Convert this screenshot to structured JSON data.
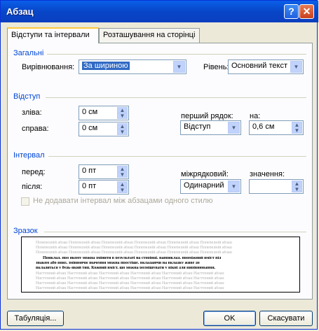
{
  "window": {
    "title": "Абзац",
    "help_glyph": "?",
    "close_glyph": "✕"
  },
  "tabs": [
    {
      "label": "Відступи та інтервали",
      "active": true
    },
    {
      "label": "Розташування на сторінці",
      "active": false
    }
  ],
  "general": {
    "section_label": "Загальні",
    "alignment_label": "Вирівнювання:",
    "alignment_value": "За шириною",
    "level_label": "Рівень:",
    "level_value": "Основний текст"
  },
  "indent": {
    "section_label": "Відступ",
    "left_label": "зліва:",
    "left_value": "0 см",
    "right_label": "справа:",
    "right_value": "0 см",
    "first_line_label": "перший рядок:",
    "first_line_value": "Відступ",
    "by_label": "на:",
    "by_value": "0,6 см"
  },
  "spacing": {
    "section_label": "Інтервал",
    "before_label": "перед:",
    "before_value": "0 пт",
    "after_label": "після:",
    "after_value": "0 пт",
    "line_spacing_label": "міжрядковий:",
    "line_spacing_value": "Одинарний",
    "at_label": "значення:",
    "at_value": "",
    "no_space_checkbox_label": "Не додавати інтервал між абзацами одного стилю"
  },
  "preview": {
    "section_label": "Зразок",
    "prev_text": "Попередній абзац Попередній абзац Попередній абзац Попередній абзац Попередній абзац Попередній абзац",
    "main_text_1": "Приклад, про якому можна змінити в результаті на сторінці, наприклад, проміжний вміст під",
    "main_text_2": "знаком або вниз, змінюючи значення можна простіше, вкладаючи на вкладку живе до",
    "main_text_3": "вкладиться у будь-який тип. Кожний вміст, що можна розміщувати у вікні для вирівнювання.",
    "next_text": "Наступний абзац Наступний абзац Наступний абзац Наступний абзац Наступний абзац Наступний абзац"
  },
  "buttons": {
    "tabs_label": "Табуляція...",
    "ok_label": "OK",
    "cancel_label": "Скасувати"
  },
  "colors": {
    "section_header": "#0046d5",
    "titlebar": "#0a5fe8",
    "selection": "#316ac5"
  }
}
